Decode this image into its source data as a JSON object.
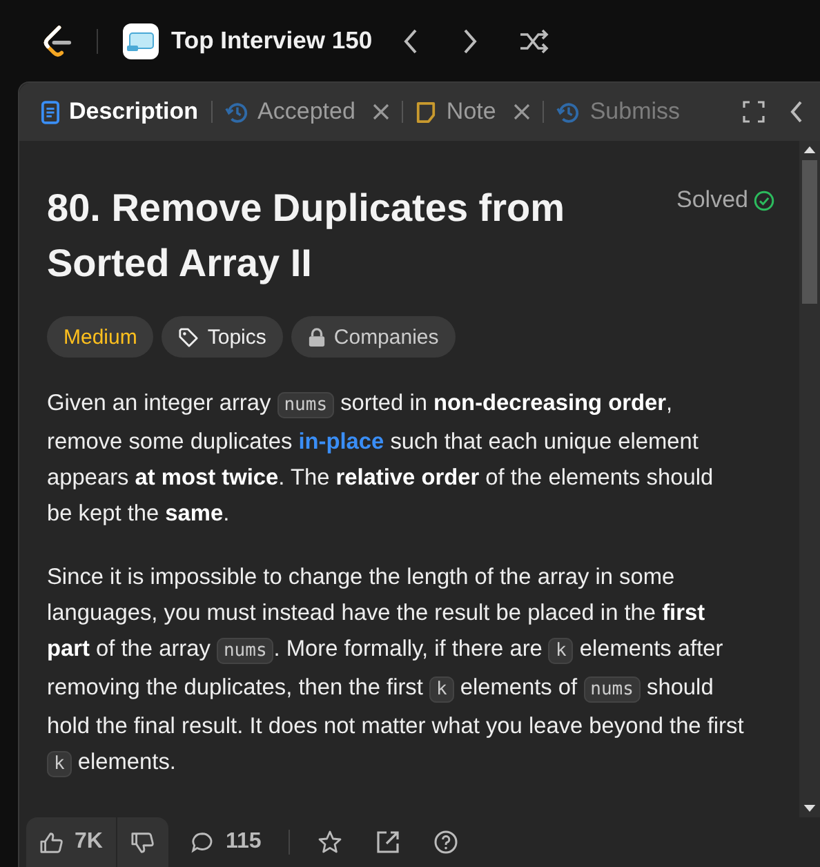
{
  "header": {
    "title": "Top Interview 150"
  },
  "tabs": [
    {
      "label": "Description",
      "kind": "doc",
      "selected": true,
      "closable": false
    },
    {
      "label": "Accepted",
      "kind": "history",
      "selected": false,
      "closable": true
    },
    {
      "label": "Note",
      "kind": "note",
      "selected": false,
      "closable": true
    },
    {
      "label": "Submiss",
      "kind": "history",
      "selected": false,
      "closable": false
    }
  ],
  "problem": {
    "title": "80. Remove Duplicates from Sorted Array II",
    "status": "Solved",
    "solved": true,
    "tags": [
      {
        "label": "Medium",
        "kind": "difficulty"
      },
      {
        "label": "Topics",
        "kind": "tag"
      },
      {
        "label": "Companies",
        "kind": "lock"
      }
    ],
    "paragraphs": [
      [
        {
          "kind": "text",
          "text": "Given an integer array "
        },
        {
          "kind": "code",
          "text": "nums"
        },
        {
          "kind": "text",
          "text": " sorted in **non-decreasing order**, remove some duplicates "
        },
        {
          "kind": "link",
          "text": "in-place"
        },
        {
          "kind": "text",
          "text": " such that each unique element appears **at most twice**. The **relative order** of the elements should be kept the **same**."
        }
      ],
      [
        {
          "kind": "text",
          "text": "Since it is impossible to change the length of the array in some languages, you must instead have the result be placed in the **first part** of the array "
        },
        {
          "kind": "code",
          "text": "nums"
        },
        {
          "kind": "text",
          "text": ". More formally, if there are "
        },
        {
          "kind": "code",
          "text": "k"
        },
        {
          "kind": "text",
          "text": " elements after removing the duplicates, then the first "
        },
        {
          "kind": "code",
          "text": "k"
        },
        {
          "kind": "text",
          "text": " elements of "
        },
        {
          "kind": "code",
          "text": "nums"
        },
        {
          "kind": "text",
          "text": " should hold the final result. It does not matter what you leave beyond the first "
        },
        {
          "kind": "code",
          "text": "k"
        },
        {
          "kind": "text",
          "text": " elements."
        }
      ]
    ]
  },
  "footer": {
    "likes": "7K",
    "comments": "115"
  }
}
